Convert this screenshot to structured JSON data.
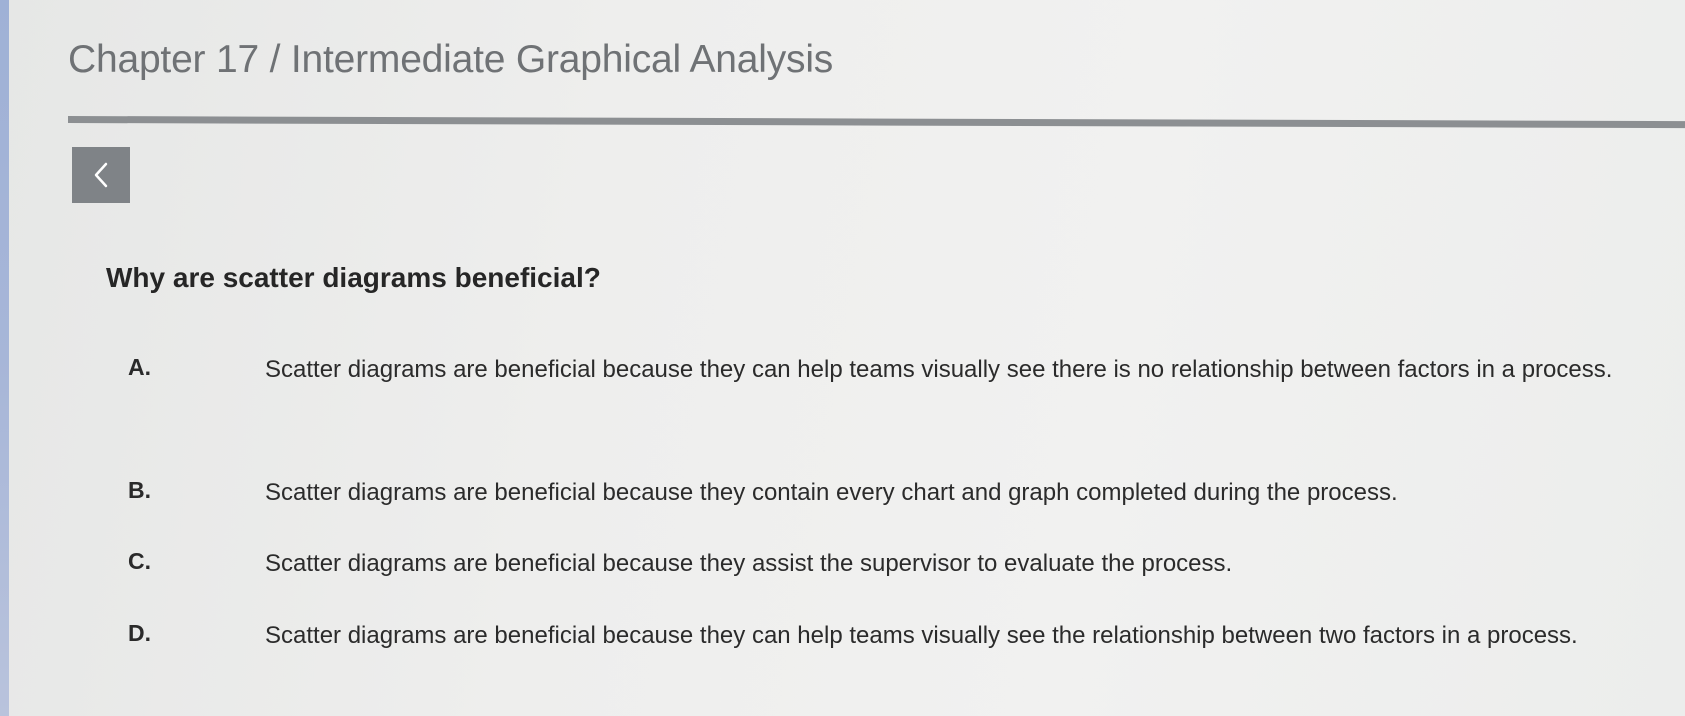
{
  "header": {
    "title": "Chapter 17 / Intermediate Graphical Analysis"
  },
  "navigation": {
    "back_icon": "chevron-left-icon"
  },
  "question": {
    "text": "Why are scatter diagrams beneficial?"
  },
  "options": [
    {
      "letter": "A.",
      "text": "Scatter diagrams are beneficial because they can help teams visually see there is no relationship between factors in a process."
    },
    {
      "letter": "B.",
      "text": "Scatter diagrams are beneficial because they contain every chart and graph completed during the process."
    },
    {
      "letter": "C.",
      "text": "Scatter diagrams are beneficial because they assist the supervisor to evaluate the process."
    },
    {
      "letter": "D.",
      "text": "Scatter diagrams are beneficial because they can help teams visually see the relationship between two factors in a process."
    }
  ],
  "colors": {
    "left_accent": "#a7b6d8",
    "back_button": "#7f8387",
    "title_text": "#6f7275"
  }
}
